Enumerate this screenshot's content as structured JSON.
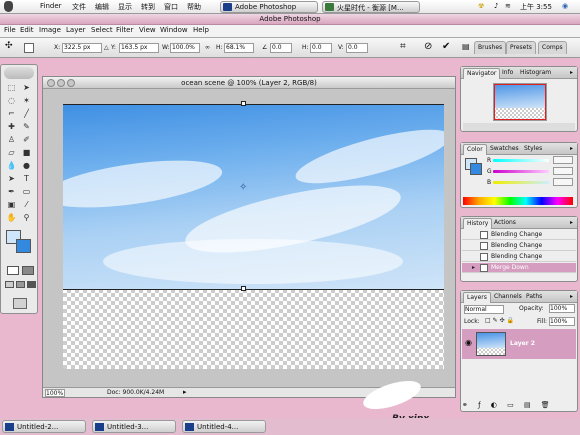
{
  "menubar": {
    "items": [
      "Finder",
      "文件",
      "编辑",
      "显示",
      "转到",
      "窗口",
      "帮助"
    ],
    "app_tab": "Adobe Photoshop",
    "other_tab": "火星时代 - 衡源 [M...",
    "time": "上午 3:55"
  },
  "photoshop": {
    "title": "Adobe Photoshop",
    "menus": [
      "File",
      "Edit",
      "Image",
      "Layer",
      "Select",
      "Filter",
      "View",
      "Window",
      "Help"
    ]
  },
  "options": {
    "x_label": "X:",
    "x_value": "322.5 px",
    "y_label": "Y:",
    "y_value": "163.5 px",
    "w_label": "W:",
    "w_value": "100.0%",
    "h_label": "H:",
    "h_value": "68.1%",
    "angle_value": "0.0",
    "hskew_label": "H:",
    "hskew_value": "0.0",
    "vskew_label": "V:",
    "vskew_value": "0.0",
    "well_tabs": [
      "Brushes",
      "Presets",
      "Comps"
    ]
  },
  "document": {
    "title": "ocean scene @ 100% (Layer 2, RGB/8)",
    "zoom": "100%",
    "doc_size": "Doc: 900.0K/4.24M"
  },
  "navigator": {
    "tabs": [
      "Navigator",
      "Info",
      "Histogram"
    ]
  },
  "color": {
    "tabs": [
      "Color",
      "Swatches",
      "Styles"
    ],
    "channels": [
      "R",
      "G",
      "B"
    ],
    "values": [
      "",
      "",
      ""
    ]
  },
  "history": {
    "tabs": [
      "History",
      "Actions"
    ],
    "items": [
      "Blending Change",
      "Blending Change",
      "Blending Change",
      "Merge Down"
    ]
  },
  "layers": {
    "tabs": [
      "Layers",
      "Channels",
      "Paths"
    ],
    "blend_mode": "Normal",
    "opacity_label": "Opacity:",
    "opacity_value": "100%",
    "lock_label": "Lock:",
    "fill_label": "Fill:",
    "fill_value": "100%",
    "layer_name": "Layer 2"
  },
  "taskbar": {
    "items": [
      "Untitled-2...",
      "Untitled-3...",
      "Untitled-4..."
    ]
  },
  "watermark": "By  xipx",
  "colors": {
    "accent": "#d59ec0",
    "sky": "#5aa5ea"
  }
}
